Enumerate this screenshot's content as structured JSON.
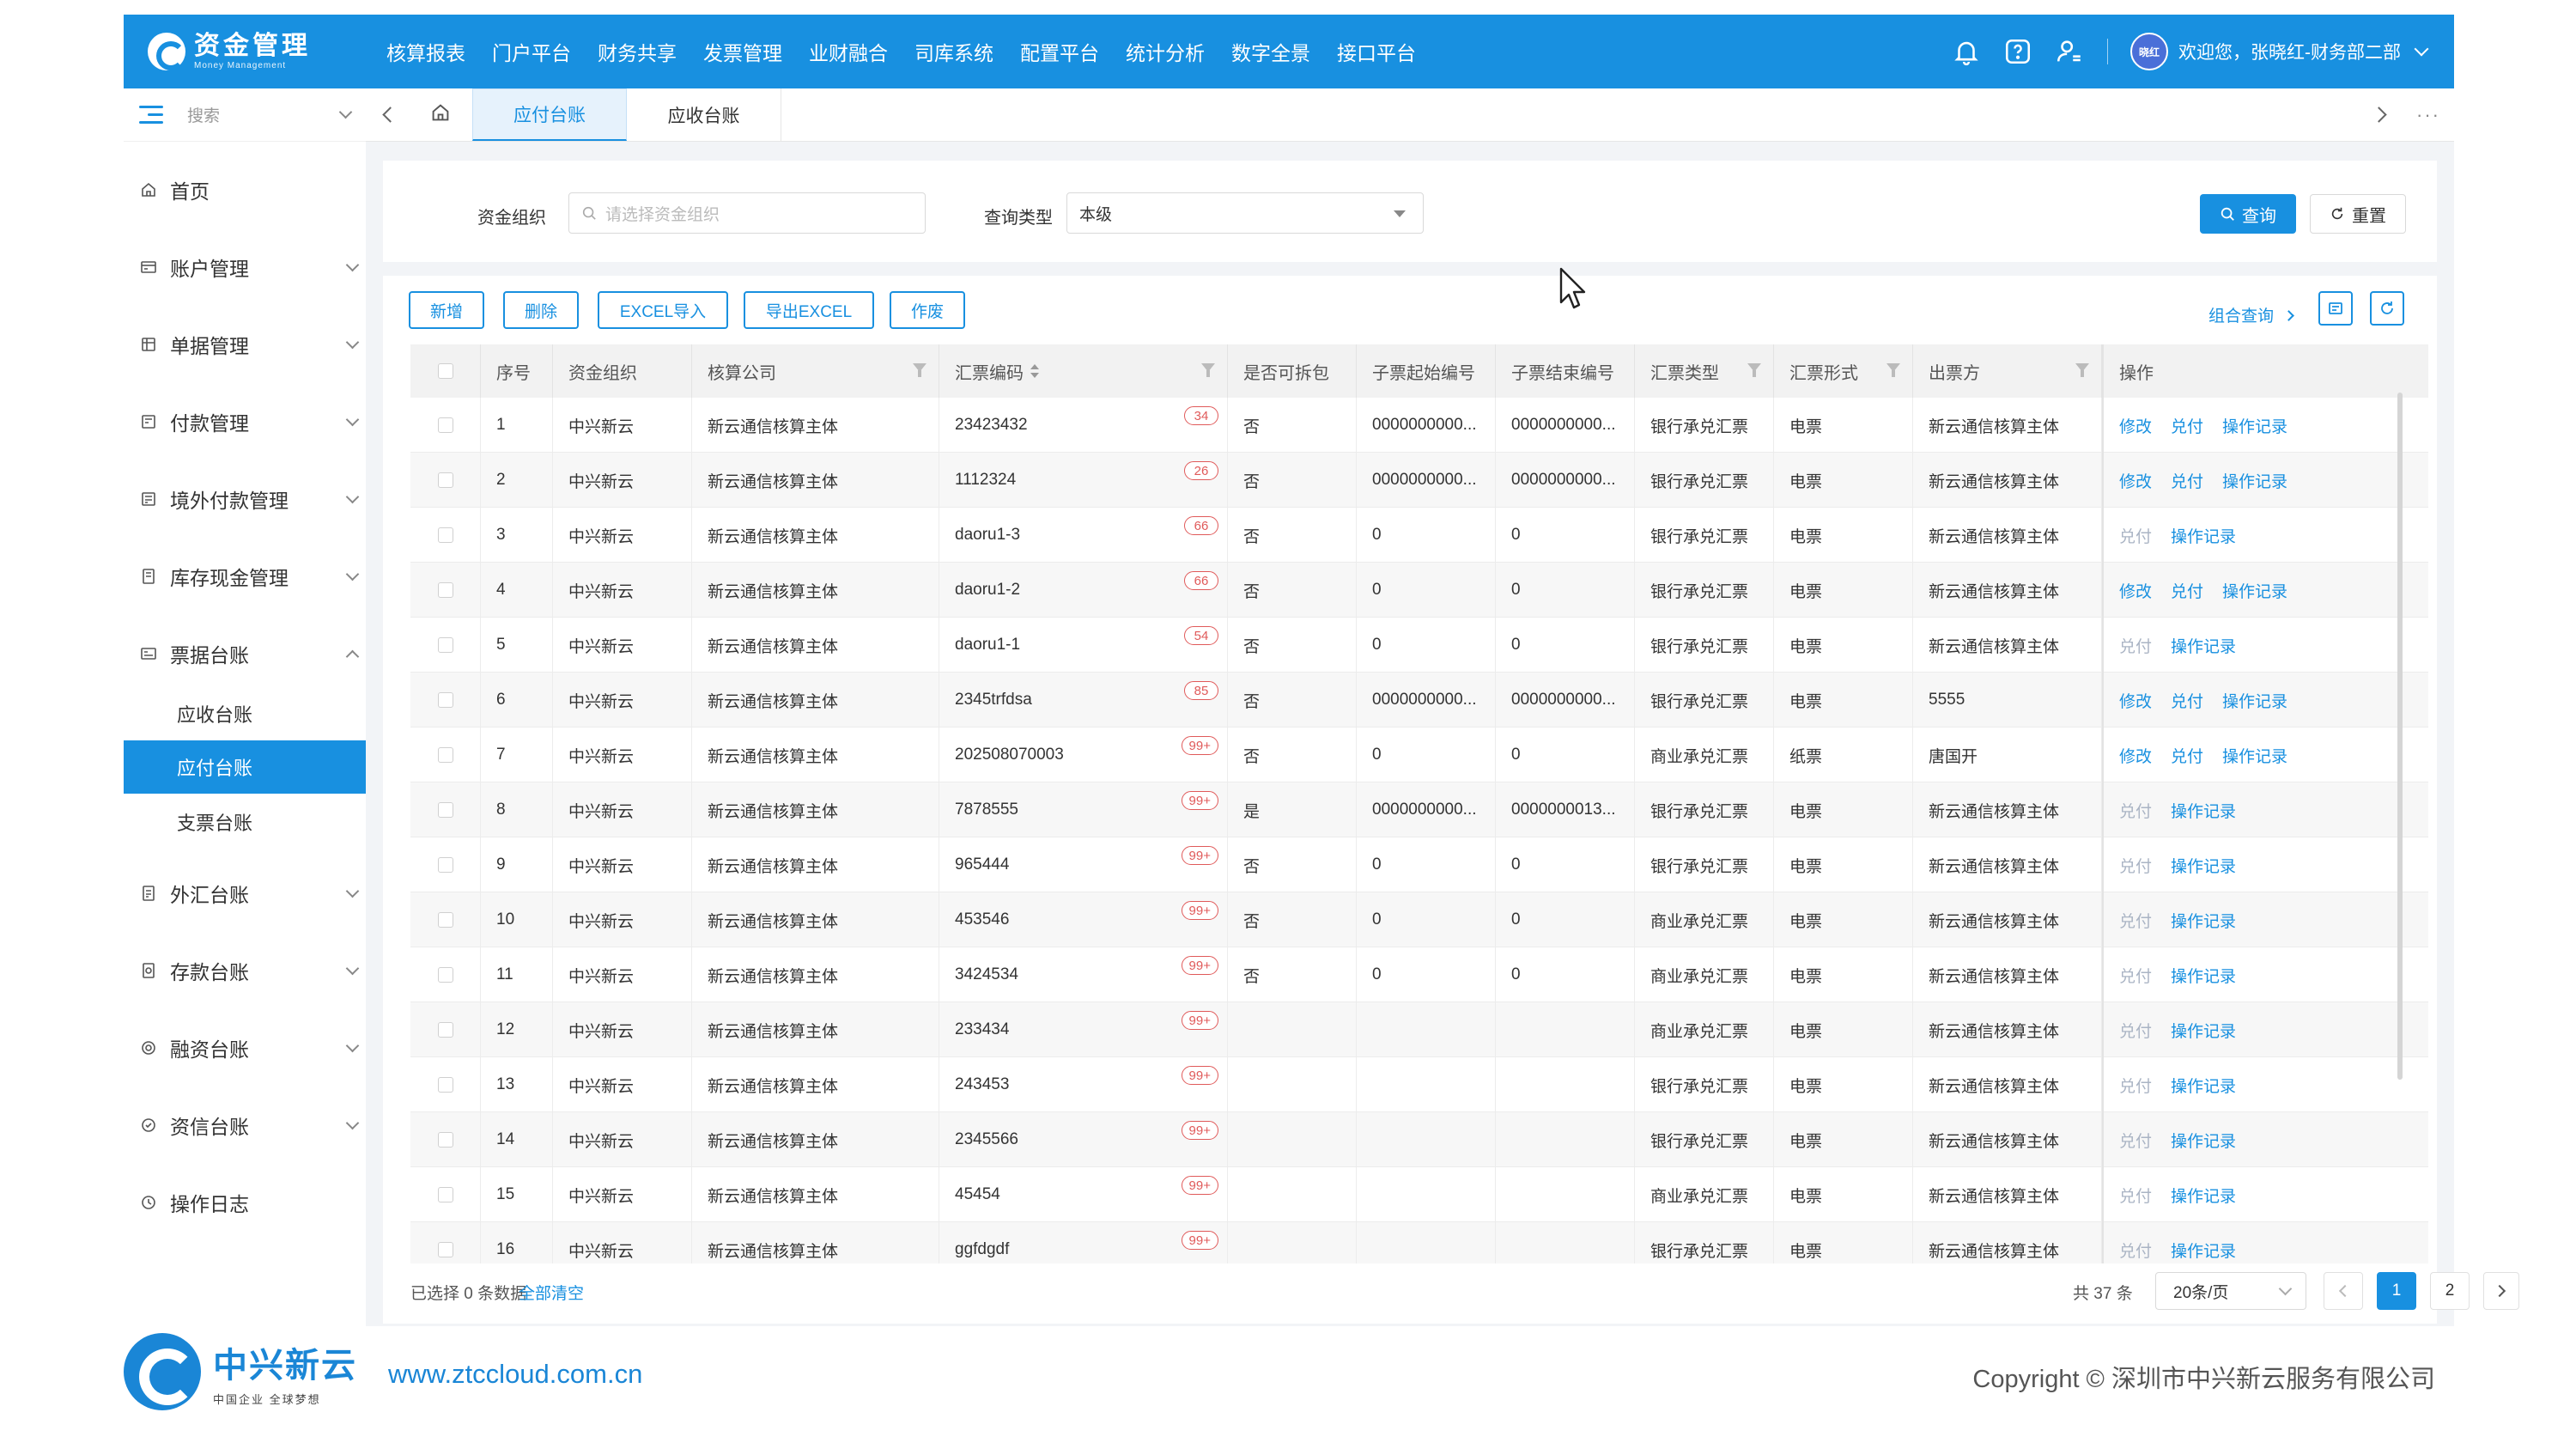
{
  "app": {
    "logo_cn": "资金管理",
    "logo_en": "Money Management",
    "nav": [
      "核算报表",
      "门户平台",
      "财务共享",
      "发票管理",
      "业财融合",
      "司库系统",
      "配置平台",
      "统计分析",
      "数字全景",
      "接口平台"
    ],
    "avatar_text": "晓红",
    "user_text": "欢迎您，张晓红-财务部二部"
  },
  "sidebar": {
    "search_placeholder": "搜索",
    "items": [
      {
        "label": "首页",
        "icon": "home-icon"
      },
      {
        "label": "账户管理",
        "icon": "account-icon"
      },
      {
        "label": "单据管理",
        "icon": "document-icon"
      },
      {
        "label": "付款管理",
        "icon": "payment-icon"
      },
      {
        "label": "境外付款管理",
        "icon": "overseas-payment-icon"
      },
      {
        "label": "库存现金管理",
        "icon": "cash-icon"
      },
      {
        "label": "票据台账",
        "icon": "bill-icon"
      },
      {
        "label": "外汇台账",
        "icon": "forex-icon"
      },
      {
        "label": "存款台账",
        "icon": "deposit-icon"
      },
      {
        "label": "融资台账",
        "icon": "finance-icon"
      },
      {
        "label": "资信台账",
        "icon": "credit-icon"
      },
      {
        "label": "操作日志",
        "icon": "log-icon"
      }
    ],
    "sub_items": [
      "应收台账",
      "应付台账",
      "支票台账"
    ]
  },
  "tabs": {
    "items": [
      "应付台账",
      "应收台账"
    ],
    "active": "应付台账"
  },
  "filter": {
    "org_label": "资金组织",
    "org_placeholder": "请选择资金组织",
    "type_label": "查询类型",
    "type_value": "本级",
    "query_label": "查询",
    "reset_label": "重置"
  },
  "toolbar": {
    "add": "新增",
    "delete": "删除",
    "import": "EXCEL导入",
    "export": "导出EXCEL",
    "void": "作废",
    "combo_query": "组合查询"
  },
  "table": {
    "headers": [
      "序号",
      "资金组织",
      "核算公司",
      "汇票编码",
      "是否可拆包",
      "子票起始编号",
      "子票结束编号",
      "汇票类型",
      "汇票形式",
      "出票方",
      "操作"
    ],
    "rows": [
      {
        "no": "1",
        "org": "中兴新云",
        "company": "新云通信核算主体",
        "code": "23423432",
        "badge": "34",
        "split": "否",
        "start": "0000000000...",
        "end": "0000000000...",
        "type": "银行承兑汇票",
        "form": "电票",
        "drawer": "新云通信核算主体",
        "actions": [
          "修改",
          "兑付",
          "操作记录"
        ],
        "muted": false
      },
      {
        "no": "2",
        "org": "中兴新云",
        "company": "新云通信核算主体",
        "code": "1112324",
        "badge": "26",
        "split": "否",
        "start": "0000000000...",
        "end": "0000000000...",
        "type": "银行承兑汇票",
        "form": "电票",
        "drawer": "新云通信核算主体",
        "actions": [
          "修改",
          "兑付",
          "操作记录"
        ],
        "muted": false
      },
      {
        "no": "3",
        "org": "中兴新云",
        "company": "新云通信核算主体",
        "code": "daoru1-3",
        "badge": "66",
        "split": "否",
        "start": "0",
        "end": "0",
        "type": "银行承兑汇票",
        "form": "电票",
        "drawer": "新云通信核算主体",
        "actions": [
          "兑付",
          "操作记录"
        ],
        "muted": true
      },
      {
        "no": "4",
        "org": "中兴新云",
        "company": "新云通信核算主体",
        "code": "daoru1-2",
        "badge": "66",
        "split": "否",
        "start": "0",
        "end": "0",
        "type": "银行承兑汇票",
        "form": "电票",
        "drawer": "新云通信核算主体",
        "actions": [
          "修改",
          "兑付",
          "操作记录"
        ],
        "muted": false
      },
      {
        "no": "5",
        "org": "中兴新云",
        "company": "新云通信核算主体",
        "code": "daoru1-1",
        "badge": "54",
        "split": "否",
        "start": "0",
        "end": "0",
        "type": "银行承兑汇票",
        "form": "电票",
        "drawer": "新云通信核算主体",
        "actions": [
          "兑付",
          "操作记录"
        ],
        "muted": true
      },
      {
        "no": "6",
        "org": "中兴新云",
        "company": "新云通信核算主体",
        "code": "2345trfdsa",
        "badge": "85",
        "split": "否",
        "start": "0000000000...",
        "end": "0000000000...",
        "type": "银行承兑汇票",
        "form": "电票",
        "drawer": "5555",
        "actions": [
          "修改",
          "兑付",
          "操作记录"
        ],
        "muted": false
      },
      {
        "no": "7",
        "org": "中兴新云",
        "company": "新云通信核算主体",
        "code": "202508070003",
        "badge": "99+",
        "split": "否",
        "start": "0",
        "end": "0",
        "type": "商业承兑汇票",
        "form": "纸票",
        "drawer": "唐国开",
        "actions": [
          "修改",
          "兑付",
          "操作记录"
        ],
        "muted": false
      },
      {
        "no": "8",
        "org": "中兴新云",
        "company": "新云通信核算主体",
        "code": "7878555",
        "badge": "99+",
        "split": "是",
        "start": "0000000000...",
        "end": "0000000013...",
        "type": "银行承兑汇票",
        "form": "电票",
        "drawer": "新云通信核算主体",
        "actions": [
          "兑付",
          "操作记录"
        ],
        "muted": true
      },
      {
        "no": "9",
        "org": "中兴新云",
        "company": "新云通信核算主体",
        "code": "965444",
        "badge": "99+",
        "split": "否",
        "start": "0",
        "end": "0",
        "type": "银行承兑汇票",
        "form": "电票",
        "drawer": "新云通信核算主体",
        "actions": [
          "兑付",
          "操作记录"
        ],
        "muted": true
      },
      {
        "no": "10",
        "org": "中兴新云",
        "company": "新云通信核算主体",
        "code": "453546",
        "badge": "99+",
        "split": "否",
        "start": "0",
        "end": "0",
        "type": "商业承兑汇票",
        "form": "电票",
        "drawer": "新云通信核算主体",
        "actions": [
          "兑付",
          "操作记录"
        ],
        "muted": true
      },
      {
        "no": "11",
        "org": "中兴新云",
        "company": "新云通信核算主体",
        "code": "3424534",
        "badge": "99+",
        "split": "否",
        "start": "0",
        "end": "0",
        "type": "商业承兑汇票",
        "form": "电票",
        "drawer": "新云通信核算主体",
        "actions": [
          "兑付",
          "操作记录"
        ],
        "muted": true
      },
      {
        "no": "12",
        "org": "中兴新云",
        "company": "新云通信核算主体",
        "code": "233434",
        "badge": "99+",
        "split": "",
        "start": "",
        "end": "",
        "type": "商业承兑汇票",
        "form": "电票",
        "drawer": "新云通信核算主体",
        "actions": [
          "兑付",
          "操作记录"
        ],
        "muted": true
      },
      {
        "no": "13",
        "org": "中兴新云",
        "company": "新云通信核算主体",
        "code": "243453",
        "badge": "99+",
        "split": "",
        "start": "",
        "end": "",
        "type": "银行承兑汇票",
        "form": "电票",
        "drawer": "新云通信核算主体",
        "actions": [
          "兑付",
          "操作记录"
        ],
        "muted": true
      },
      {
        "no": "14",
        "org": "中兴新云",
        "company": "新云通信核算主体",
        "code": "2345566",
        "badge": "99+",
        "split": "",
        "start": "",
        "end": "",
        "type": "银行承兑汇票",
        "form": "电票",
        "drawer": "新云通信核算主体",
        "actions": [
          "兑付",
          "操作记录"
        ],
        "muted": true
      },
      {
        "no": "15",
        "org": "中兴新云",
        "company": "新云通信核算主体",
        "code": "45454",
        "badge": "99+",
        "split": "",
        "start": "",
        "end": "",
        "type": "商业承兑汇票",
        "form": "电票",
        "drawer": "新云通信核算主体",
        "actions": [
          "兑付",
          "操作记录"
        ],
        "muted": true
      },
      {
        "no": "16",
        "org": "中兴新云",
        "company": "新云通信核算主体",
        "code": "ggfdgdf",
        "badge": "99+",
        "split": "",
        "start": "",
        "end": "",
        "type": "银行承兑汇票",
        "form": "电票",
        "drawer": "新云通信核算主体",
        "actions": [
          "兑付",
          "操作记录"
        ],
        "muted": true
      }
    ]
  },
  "footer_bar": {
    "selected": "已选择 0 条数据",
    "clear_all": "全部清空",
    "total": "共 37 条",
    "page_size": "20条/页",
    "pages": [
      "1",
      "2"
    ],
    "current_page": "1"
  },
  "footer": {
    "brand_cn": "中兴新云",
    "brand_sub": "中国企业 全球梦想",
    "url": "www.ztccloud.com.cn",
    "copyright": "Copyright © 深圳市中兴新云服务有限公司"
  },
  "colors": {
    "primary": "#1890e0",
    "badge": "#e05a5a",
    "muted_action": "#aab4c4"
  }
}
